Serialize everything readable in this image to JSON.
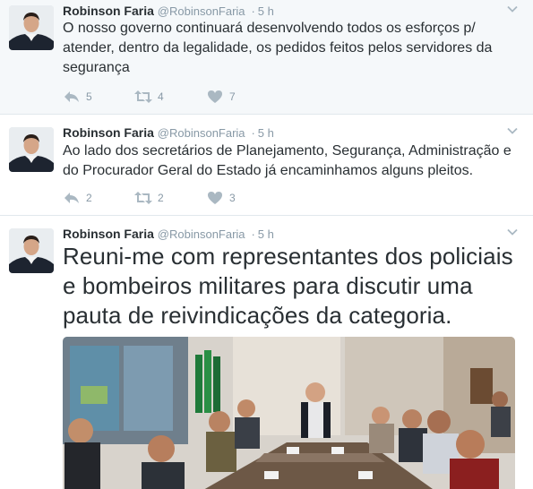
{
  "tweets": [
    {
      "name": "Robinson Faria",
      "handle": "@RobinsonFaria",
      "separator": "·",
      "time": "5 h",
      "text": "O nosso governo continuará desenvolvendo todos os esforços p/ atender, dentro da legalidade, os pedidos feitos pelos servidores da segurança",
      "replies": "5",
      "retweets": "4",
      "likes": "7"
    },
    {
      "name": "Robinson Faria",
      "handle": "@RobinsonFaria",
      "separator": "·",
      "time": "5 h",
      "text": "Ao lado dos secretários de Planejamento, Segurança, Administração e do Procurador Geral do Estado já encaminhamos alguns pleitos.",
      "replies": "2",
      "retweets": "2",
      "likes": "3"
    },
    {
      "name": "Robinson Faria",
      "handle": "@RobinsonFaria",
      "separator": "·",
      "time": "5 h",
      "text": "Reuni-me com representantes dos policiais e bombeiros militares para discutir uma pauta de reivindicações da categoria."
    }
  ],
  "colors": {
    "text": "#292f33",
    "muted": "#8899a6",
    "highlight_bg": "#f5f8fa",
    "border": "#e1e8ed"
  },
  "icons": [
    "reply-icon",
    "retweet-icon",
    "like-icon",
    "caret-down-icon"
  ]
}
